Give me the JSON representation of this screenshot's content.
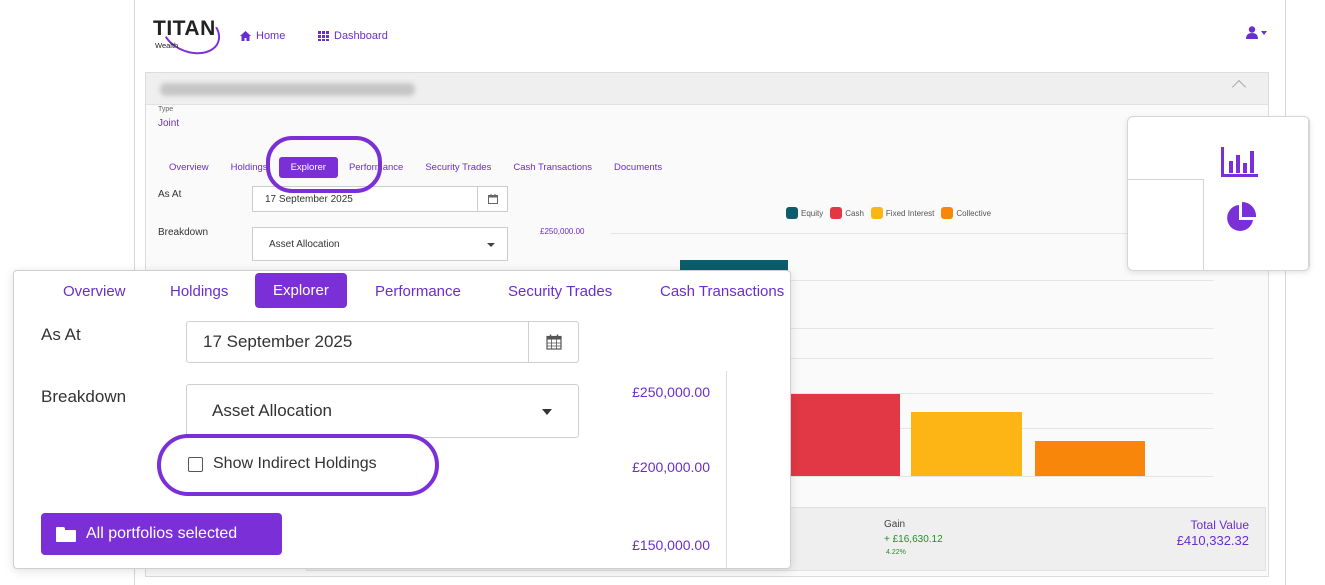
{
  "nav": {
    "brand": "TITAN",
    "brand_sub": "Wealth",
    "home_label": "Home",
    "dashboard_label": "Dashboard"
  },
  "client": {
    "type_label": "Type",
    "type_value": "Joint"
  },
  "tabs": [
    {
      "label": "Overview"
    },
    {
      "label": "Holdings"
    },
    {
      "label": "Explorer",
      "active": true
    },
    {
      "label": "Performance"
    },
    {
      "label": "Security Trades"
    },
    {
      "label": "Cash Transactions"
    },
    {
      "label": "Documents"
    }
  ],
  "form": {
    "as_at_label": "As At",
    "as_at_value": "17 September 2025",
    "breakdown_label": "Breakdown",
    "breakdown_value": "Asset Allocation",
    "indirect_label": "Show Indirect Holdings",
    "indirect_checked": false,
    "portfolios_button": "All portfolios selected"
  },
  "chart_data": {
    "type": "bar",
    "categories": [
      "Equity",
      "Cash",
      "Fixed Interest",
      "Collective"
    ],
    "colors": [
      "#0d5c6b",
      "#e23744",
      "#fdb515",
      "#f7860b"
    ],
    "y_tick_labels_small": [
      "£250,000.00"
    ],
    "y_tick_labels": [
      "£250,000.00",
      "£200,000.00",
      "£150,000.00"
    ],
    "legend_position": "top"
  },
  "summary": {
    "gain_label": "Gain",
    "gain_value": "+ £16,630.12",
    "gain_pct": "4.22%",
    "total_label": "Total Value",
    "total_value": "£410,332.32"
  },
  "colors": {
    "accent": "#7b2fd6",
    "link": "#6a2ed0"
  },
  "icons": {
    "home": "home-icon",
    "dashboard": "grid-icon",
    "user": "user-icon",
    "calendar": "calendar-icon",
    "folder": "folder-icon",
    "bar_chart": "bar-chart-icon",
    "pie_chart": "pie-chart-icon"
  }
}
